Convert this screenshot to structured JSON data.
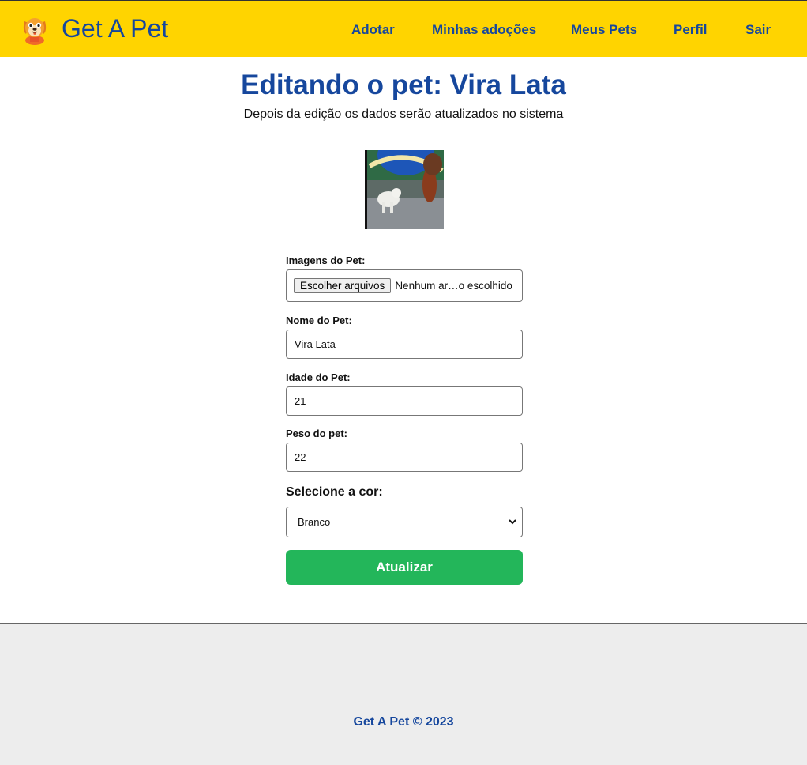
{
  "navbar": {
    "brand": "Get A Pet",
    "links": [
      "Adotar",
      "Minhas adoções",
      "Meus Pets",
      "Perfil",
      "Sair"
    ]
  },
  "page": {
    "title": "Editando o pet: Vira Lata",
    "subtitle": "Depois da edição os dados serão atualizados no sistema"
  },
  "form": {
    "images_label": "Imagens do Pet:",
    "file_button": "Escolher arquivos",
    "file_status": "Nenhum ar…o escolhido",
    "name_label": "Nome do Pet:",
    "name_value": "Vira Lata",
    "age_label": "Idade do Pet:",
    "age_value": "21",
    "weight_label": "Peso do pet:",
    "weight_value": "22",
    "color_label": "Selecione a cor:",
    "color_value": "Branco",
    "submit_label": "Atualizar"
  },
  "footer": {
    "text": "Get A Pet © 2023"
  },
  "colors": {
    "navbar_bg": "#ffd400",
    "brand_blue": "#16479d",
    "submit_green": "#23b65a",
    "footer_bg": "#ededed"
  }
}
